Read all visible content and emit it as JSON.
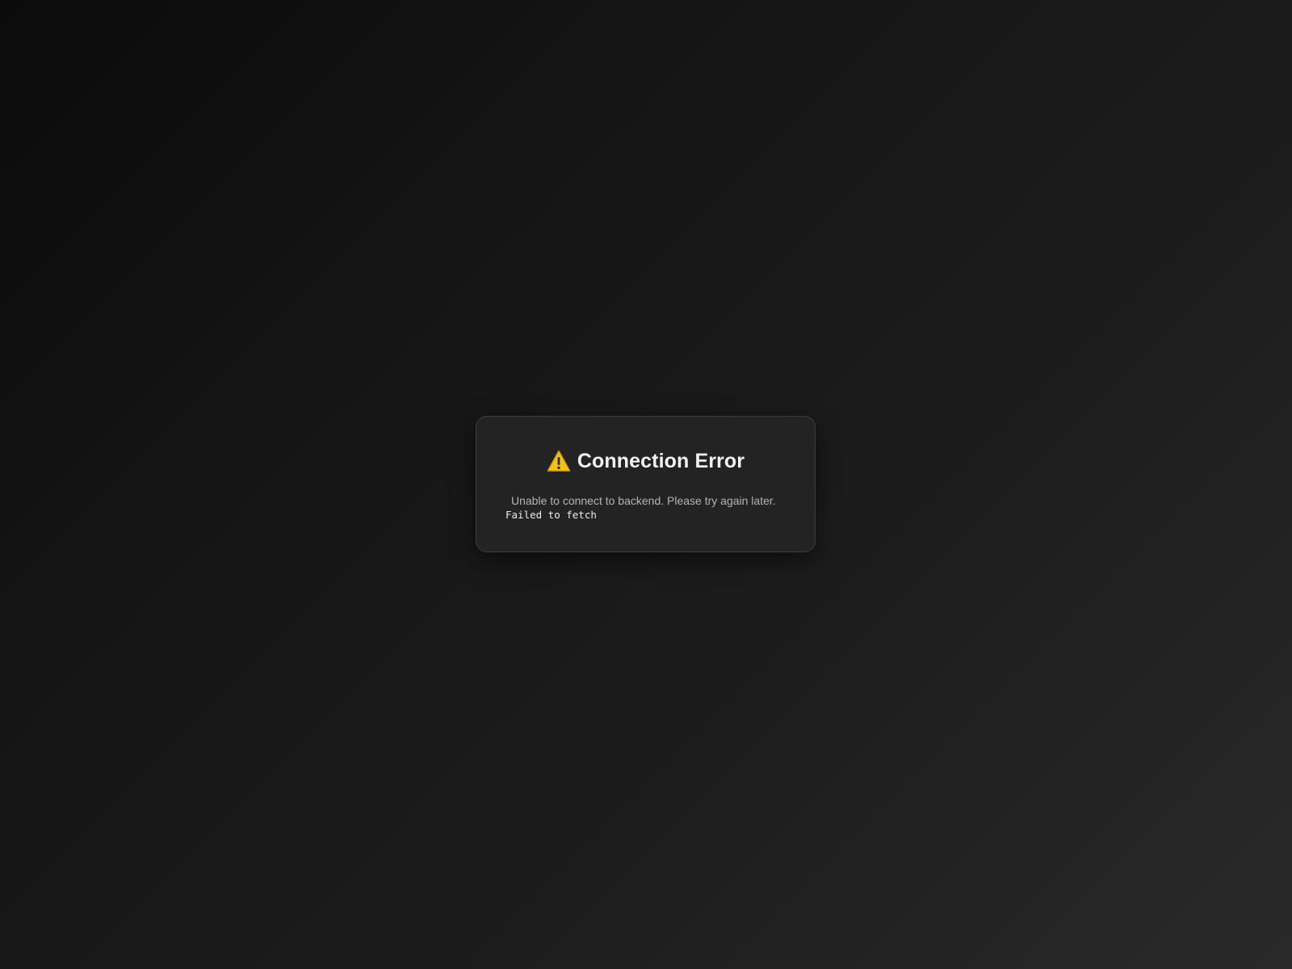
{
  "error_card": {
    "title": "Connection Error",
    "icon": "warning-icon",
    "message": "Unable to connect to backend. Please try again later.",
    "detail": "Failed to fetch"
  },
  "colors": {
    "background_dark": "#0b0b0b",
    "background_light": "#2a2a2a",
    "card_background": "#232323",
    "card_border": "#3a3a3a",
    "title_text": "#f2f2f2",
    "message_text": "#b4b4b4",
    "warning_yellow": "#f5c211"
  }
}
